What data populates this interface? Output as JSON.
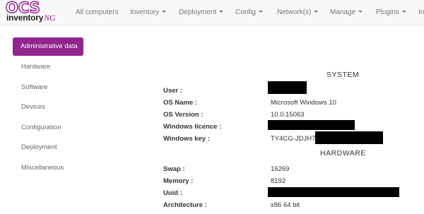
{
  "brand": {
    "logo_top": "OCS",
    "logo_bottom": "inventory",
    "logo_suffix": "NG"
  },
  "nav": {
    "items": [
      {
        "label": "All computers",
        "has_caret": false
      },
      {
        "label": "Inventory",
        "has_caret": true
      },
      {
        "label": "Deployment",
        "has_caret": true
      },
      {
        "label": "Config",
        "has_caret": true
      },
      {
        "label": "Network(s)",
        "has_caret": true
      },
      {
        "label": "Manage",
        "has_caret": true
      },
      {
        "label": "Plugins",
        "has_caret": true
      },
      {
        "label": "In",
        "has_caret": false
      }
    ]
  },
  "sidebar": {
    "active": "Administrative data",
    "items": [
      "Hardware",
      "Software",
      "Devices",
      "Configuration",
      "Deployment",
      "Miscellaneous"
    ]
  },
  "system": {
    "title": "SYSTEM",
    "user_label": "User :",
    "os_name_label": "OS Name :",
    "os_name_value": "Microsoft Windows 10",
    "os_version_label": "OS Version :",
    "os_version_value": "10.0.15063",
    "licence_label": "Windows licence :",
    "key_label": "Windows key :",
    "key_value": "TY4CG-JDJH7-"
  },
  "hardware": {
    "title": "HARDWARE",
    "swap_label": "Swap :",
    "swap_value": "16269",
    "memory_label": "Memory :",
    "memory_value": "8192",
    "uuid_label": "Uuid :",
    "arch_label": "Architecture :",
    "arch_value": "x86 64 bit"
  },
  "colors": {
    "accent": "#91248d",
    "navbar_bg": "#f8f8f8",
    "redaction": "#000000"
  }
}
